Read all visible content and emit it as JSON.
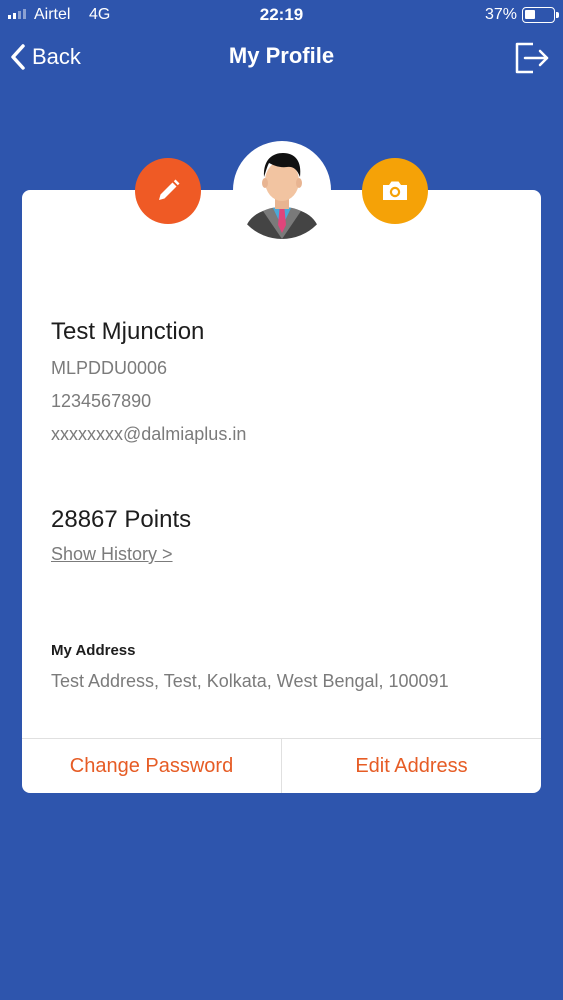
{
  "status_bar": {
    "carrier": "Airtel",
    "network": "4G",
    "time": "22:19",
    "battery_percent": "37%",
    "battery_level": 0.37
  },
  "nav": {
    "back_label": "Back",
    "title": "My Profile",
    "logout_icon": "logout-icon"
  },
  "profile": {
    "avatar_icon": "user-avatar",
    "edit_icon": "pencil-icon",
    "camera_icon": "camera-icon",
    "name": "Test Mjunction",
    "code": "MLPDDU0006",
    "phone": "1234567890",
    "email": "xxxxxxxx@dalmiaplus.in",
    "points": "28867 Points",
    "history_link": "Show History >",
    "address_heading": "My Address",
    "address": "Test Address, Test, Kolkata, West Bengal, 100091"
  },
  "actions": {
    "change_password": "Change Password",
    "edit_address": "Edit Address"
  },
  "colors": {
    "background": "#2e55ad",
    "edit_button": "#ef5a25",
    "camera_button": "#f5a207",
    "action_text": "#e65c25"
  }
}
